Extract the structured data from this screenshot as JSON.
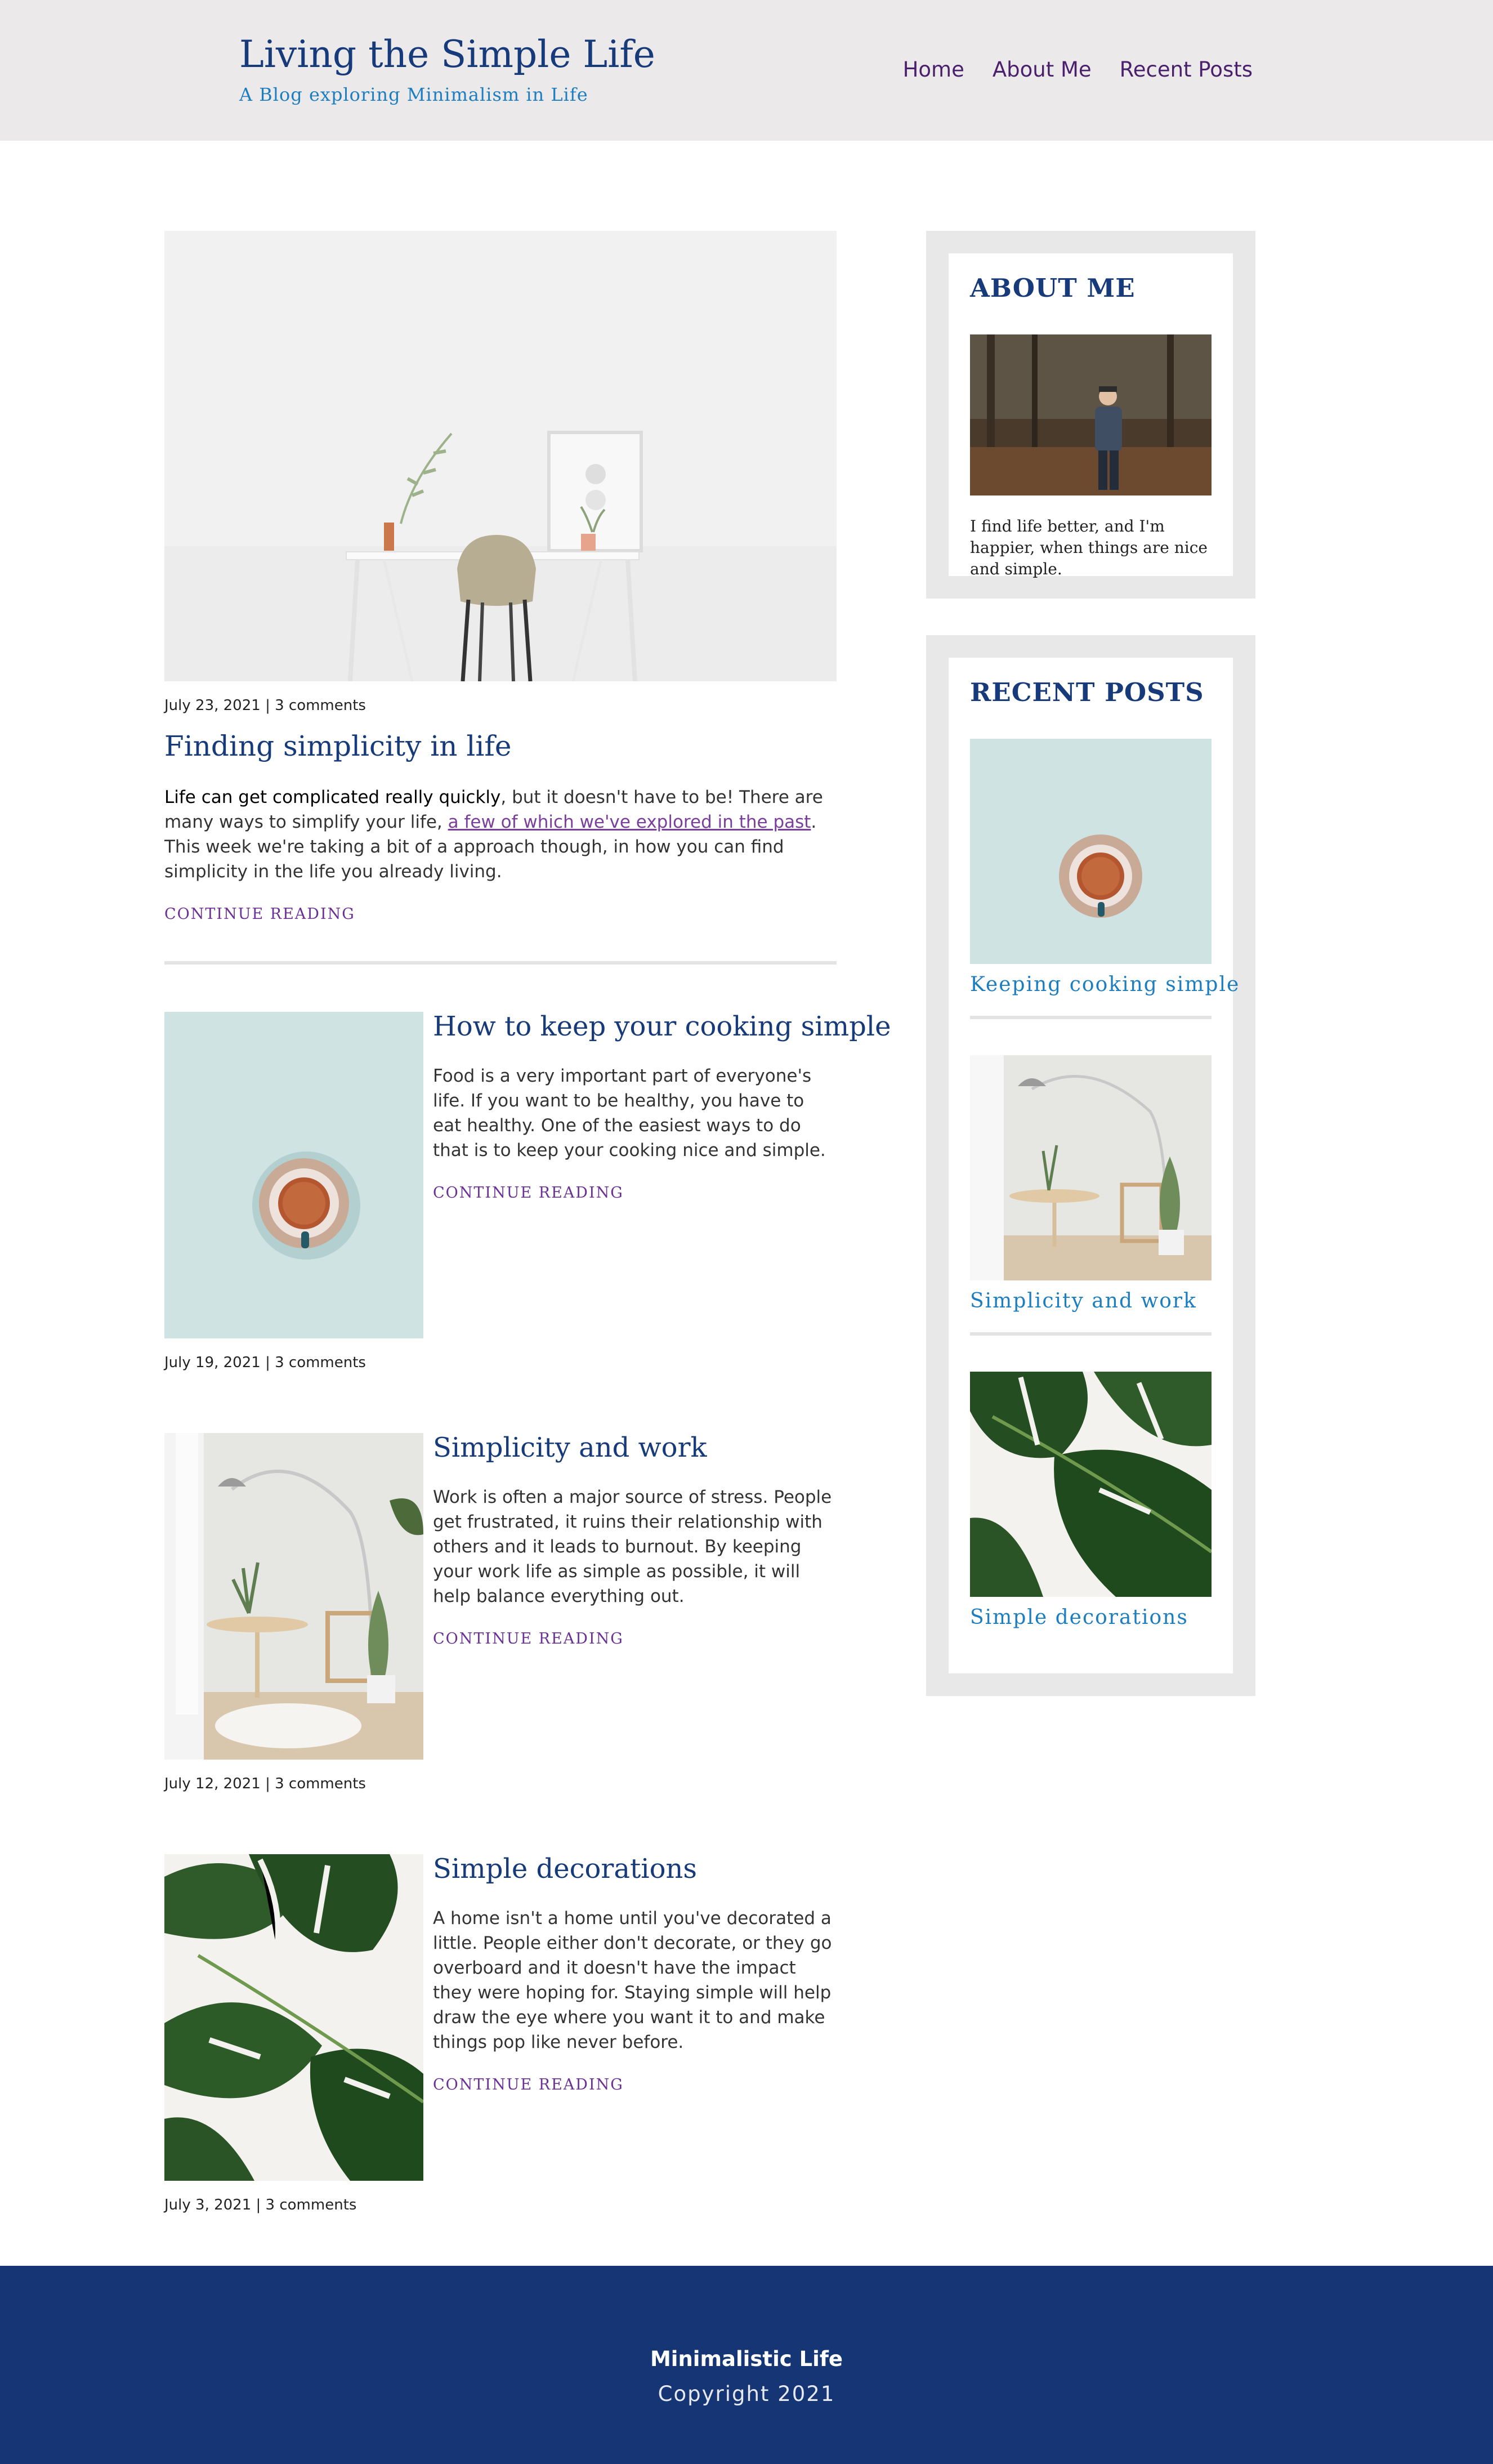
{
  "header": {
    "title": "Living the Simple Life",
    "tagline": "A Blog exploring Minimalism in Life",
    "nav": [
      "Home",
      "About Me",
      "Recent Posts"
    ]
  },
  "featured": {
    "meta": "July 23, 2021 | 3 comments",
    "title": "Finding simplicity in life",
    "excerpt_bold": "Life can get complicated really quickly",
    "excerpt_1": ", but it doesn't have to be! There are many ways to simplify your life, ",
    "excerpt_link": "a few of which we've explored in the past",
    "excerpt_2": ". This week we're taking a bit of a approach though, in how you can find simplicity in the life you already living.",
    "continue": "Continue Reading"
  },
  "posts": [
    {
      "title": "How to keep your cooking simple",
      "excerpt": "Food is a very important part of everyone's life. If you want to be healthy, you have to eat healthy. One of the easiest ways to do that is to keep your cooking nice and simple.",
      "continue": "Continue Reading",
      "meta": "July 19, 2021 | 3 comments"
    },
    {
      "title": "Simplicity and work",
      "excerpt": "Work is often a major source of stress. People get frustrated, it ruins their relationship with others and it leads to burnout. By keeping your work life as simple as possible, it will help balance everything out.",
      "continue": "Continue Reading",
      "meta": "July 12, 2021 | 3 comments"
    },
    {
      "title": "Simple decorations",
      "excerpt": "A home isn't a home until you've decorated a little. People either don't decorate, or they go overboard and it doesn't have the impact they were hoping for. Staying simple will help draw the eye where you want it to and make things pop like never before.",
      "continue": "Continue Reading",
      "meta": "July 3, 2021 | 3 comments"
    }
  ],
  "sidebar": {
    "about_title": "ABOUT ME",
    "about_text": "I find life better, and I'm happier, when things are nice and simple.",
    "recent_title": "RECENT POSTS",
    "recent": [
      "Keeping cooking simple",
      "Simplicity and work",
      "Simple decorations"
    ]
  },
  "footer": {
    "name": "Minimalistic Life",
    "copyright": "Copyright 2021"
  },
  "colors": {
    "navy": "#173a7a",
    "accent_blue": "#1c7ec0",
    "purple": "#6b2f95",
    "footer_bg": "#163574",
    "header_bg": "#ebe9e9"
  }
}
